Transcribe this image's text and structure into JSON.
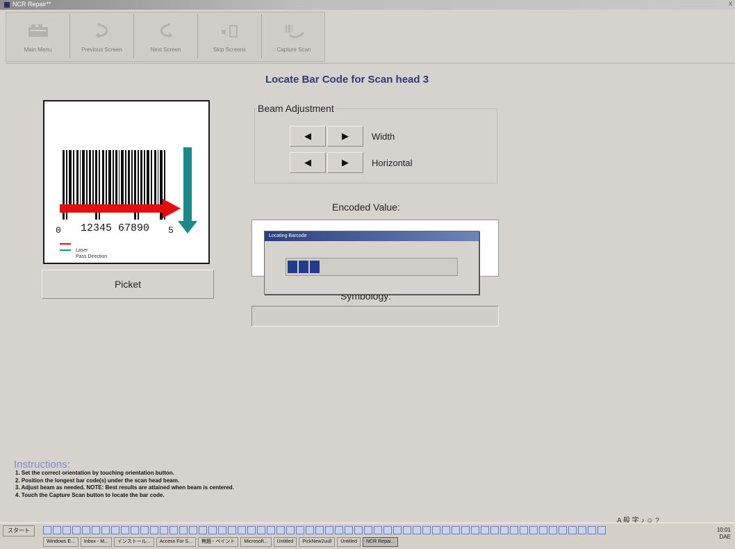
{
  "titlebar": {
    "title": "NCR Repair**",
    "close_glyph": "x"
  },
  "toolbar": {
    "buttons": [
      {
        "label": "Main Menu",
        "icon": "main-menu-icon"
      },
      {
        "label": "Previous Screen",
        "icon": "previous-screen-icon"
      },
      {
        "label": "Next Screen",
        "icon": "next-screen-icon"
      },
      {
        "label": "Skip Screens",
        "icon": "skip-screens-icon"
      },
      {
        "label": "Capture Scan",
        "icon": "capture-scan-icon"
      }
    ]
  },
  "page": {
    "title": "Locate Bar Code for Scan head 3"
  },
  "barcode": {
    "digits_left": "0",
    "digits_main": "12345 67890",
    "digits_right": "5",
    "legend": {
      "laser": "Laser",
      "pass_direction": "Pass Direction"
    },
    "colors": {
      "laser": "#e01010",
      "pass": "#1a8a8a"
    }
  },
  "picket_button": {
    "label": "Picket"
  },
  "beam_adjustment": {
    "title": "Beam Adjustment",
    "rows": [
      {
        "label": "Width",
        "left": "◀",
        "right": "▶"
      },
      {
        "label": "Horizontal",
        "left": "◀",
        "right": "▶"
      }
    ]
  },
  "encoded": {
    "label": "Encoded Value:"
  },
  "progress_dialog": {
    "title": "Locating Barcode",
    "progress_fraction": 0.2
  },
  "symbology": {
    "label": "Symbology:"
  },
  "instructions": {
    "heading": "Instructions:",
    "steps": [
      "1. Set the correct orientation by touching orientation button.",
      "2. Position the longest bar code(s) under the scan head beam.",
      "3. Adjust beam as needed.  NOTE: Best results are attained when beam is centered.",
      "4. Touch the Capture Scan button to locate the bar code."
    ]
  },
  "taskbar": {
    "start": "スタート",
    "tray_top": "A 般 字 ♪ ☺ ?",
    "clock_time": "10:01",
    "clock_day": "DAE",
    "tasks": [
      {
        "label": "Windows E..."
      },
      {
        "label": "Inbox - M..."
      },
      {
        "label": "インストール..."
      },
      {
        "label": "Access For S..."
      },
      {
        "label": "無題 - ペイント"
      },
      {
        "label": "Microsoft..."
      },
      {
        "label": "Untitled"
      },
      {
        "label": "PickNew2uull"
      },
      {
        "label": "Untitled"
      },
      {
        "label": "NCR Repai..."
      }
    ]
  }
}
